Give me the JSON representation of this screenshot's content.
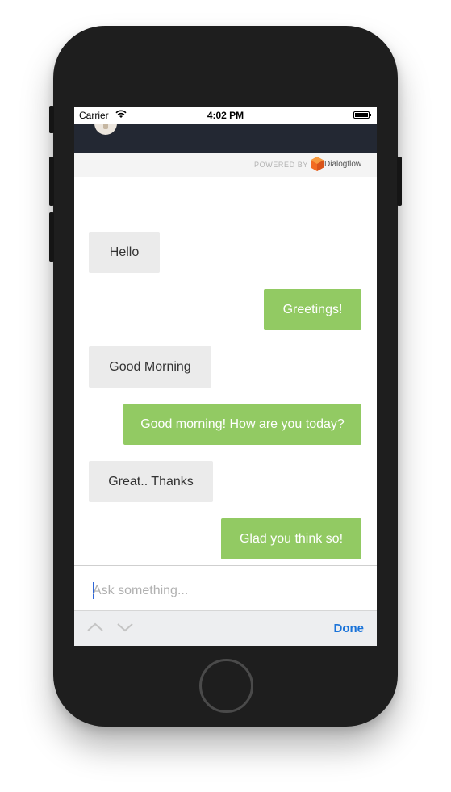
{
  "status_bar": {
    "carrier": "Carrier",
    "time": "4:02 PM",
    "wifi_icon": "wifi-icon",
    "battery_icon": "battery-icon"
  },
  "header": {
    "avatar_icon": "bot-avatar-icon"
  },
  "powered_by": {
    "label": "POWERED BY",
    "brand": "Dialogflow",
    "brand_color": "#f26b21"
  },
  "messages": [
    {
      "sender": "user",
      "text": "Hello"
    },
    {
      "sender": "bot",
      "text": "Greetings!"
    },
    {
      "sender": "user",
      "text": "Good Morning"
    },
    {
      "sender": "bot",
      "text": "Good morning! How are you today?"
    },
    {
      "sender": "user",
      "text": "Great.. Thanks"
    },
    {
      "sender": "bot",
      "text": "Glad you think so!"
    }
  ],
  "input": {
    "placeholder": "Ask something...",
    "value": ""
  },
  "keyboard_toolbar": {
    "prev_icon": "chevron-up-icon",
    "next_icon": "chevron-down-icon",
    "done_label": "Done"
  },
  "colors": {
    "bot_bubble": "#92ca63",
    "user_bubble": "#ebebeb",
    "header": "#232833",
    "accent": "#1a73d9"
  }
}
